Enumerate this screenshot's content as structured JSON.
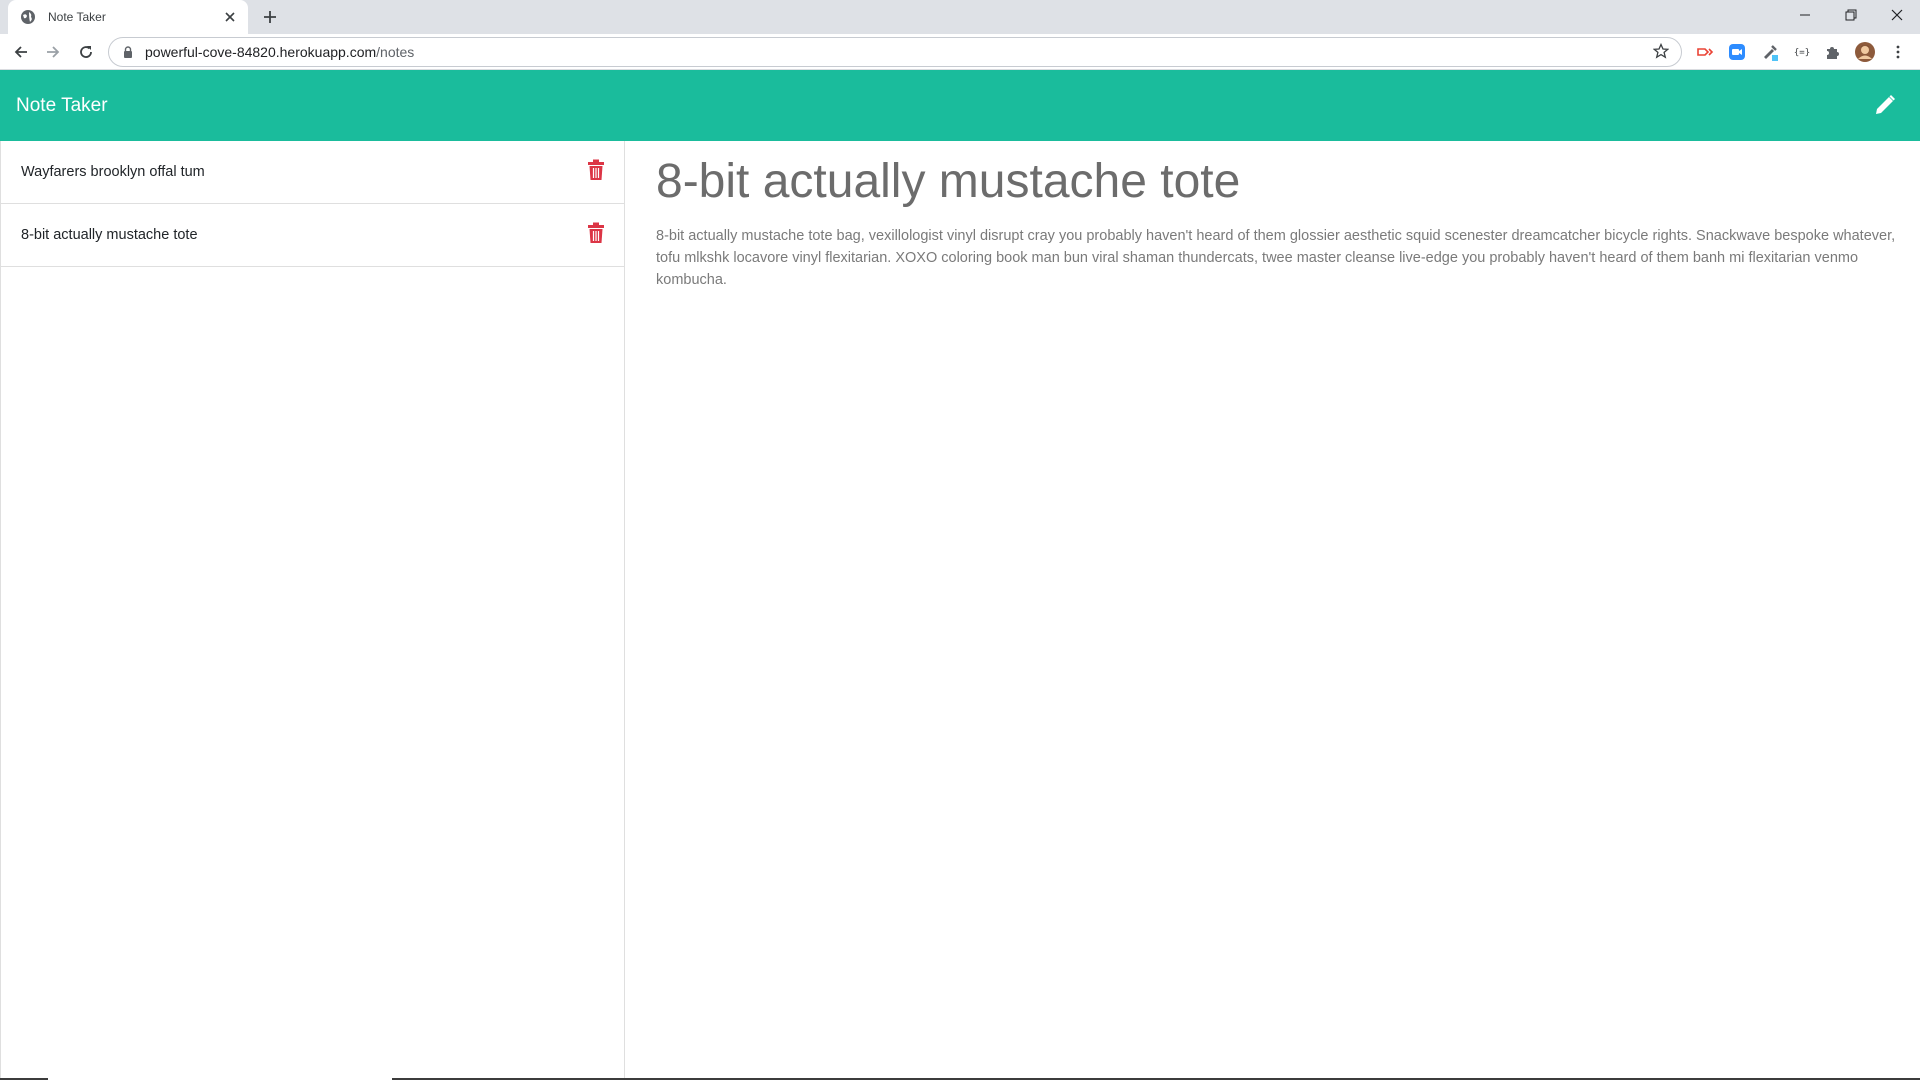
{
  "browser": {
    "tab_title": "Note Taker",
    "url_host": "powerful-cove-84820.herokuapp.com",
    "url_path": "/notes"
  },
  "app": {
    "brand": "Note Taker",
    "accent_color": "#1abc9c",
    "delete_color": "#dc3545",
    "notes": [
      {
        "title": "Wayfarers brooklyn offal tum"
      },
      {
        "title": "8-bit actually mustache tote"
      }
    ],
    "active_note": {
      "title": "8-bit actually mustache tote",
      "text": "8-bit actually mustache tote bag, vexillologist vinyl disrupt cray you probably haven't heard of them glossier aesthetic squid scenester dreamcatcher bicycle rights. Snackwave bespoke whatever, tofu mlkshk locavore vinyl flexitarian. XOXO coloring book man bun viral shaman thundercats, twee master cleanse live-edge you probably haven't heard of them banh mi flexitarian venmo kombucha."
    }
  }
}
